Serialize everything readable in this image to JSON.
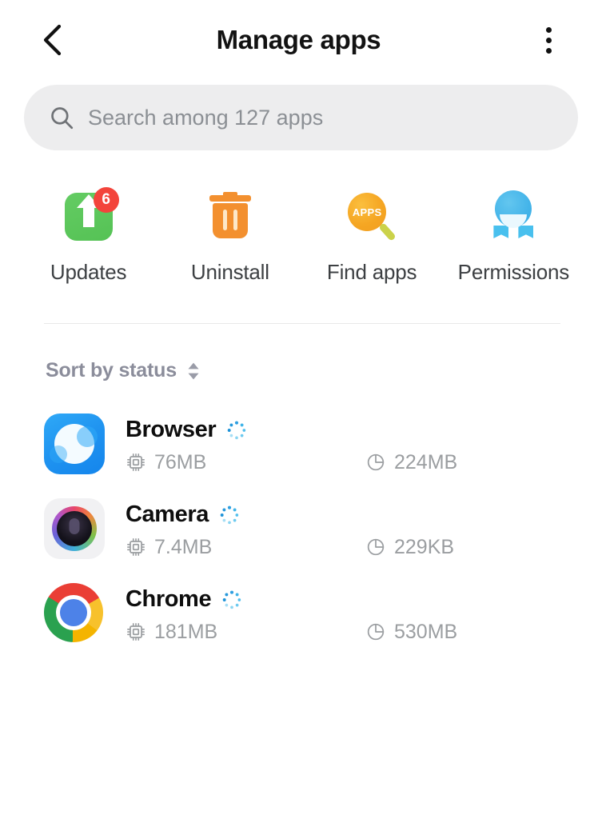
{
  "header": {
    "title": "Manage apps",
    "back_icon": "chevron-left-icon",
    "menu_icon": "overflow-menu-icon"
  },
  "search": {
    "placeholder": "Search among 127 apps",
    "value": "",
    "icon": "search-icon",
    "app_count": 127
  },
  "quick_actions": [
    {
      "label": "Updates",
      "icon": "updates-icon",
      "badge": "6",
      "badge_color": "#f3443b",
      "color": "#5cc95c"
    },
    {
      "label": "Uninstall",
      "icon": "trash-icon",
      "badge": "",
      "color": "#f3902f"
    },
    {
      "label": "Find apps",
      "icon": "find-apps-icon",
      "badge": "",
      "color": "#f5a623",
      "glyph_text": "APPS"
    },
    {
      "label": "Permissions",
      "icon": "permissions-icon",
      "badge": "",
      "color": "#44b4e9"
    }
  ],
  "sort": {
    "label": "Sort by status",
    "icon": "sort-chevrons-icon"
  },
  "apps": [
    {
      "name": "Browser",
      "icon": "browser-app-icon",
      "status_icon": "loading-spinner-icon",
      "ram_icon": "cpu-icon",
      "ram": "76MB",
      "storage_icon": "storage-pie-icon",
      "storage": "224MB"
    },
    {
      "name": "Camera",
      "icon": "camera-app-icon",
      "status_icon": "loading-spinner-icon",
      "ram_icon": "cpu-icon",
      "ram": "7.4MB",
      "storage_icon": "storage-pie-icon",
      "storage": "229KB"
    },
    {
      "name": "Chrome",
      "icon": "chrome-app-icon",
      "status_icon": "loading-spinner-icon",
      "ram_icon": "cpu-icon",
      "ram": "181MB",
      "storage_icon": "storage-pie-icon",
      "storage": "530MB"
    }
  ]
}
